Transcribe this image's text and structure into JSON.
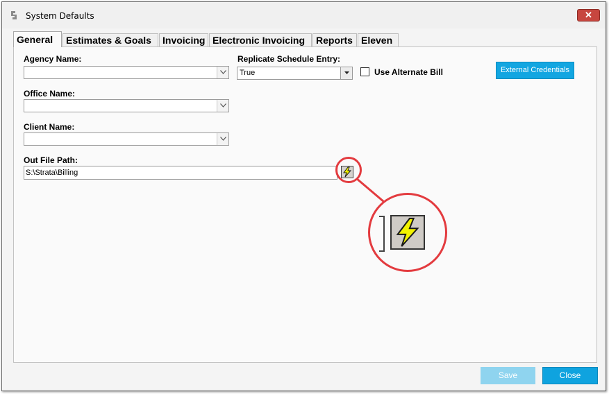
{
  "window": {
    "title": "System Defaults",
    "close_glyph": "✕"
  },
  "tabs": [
    {
      "label": "General",
      "active": true
    },
    {
      "label": "Estimates & Goals",
      "active": false
    },
    {
      "label": "Invoicing",
      "active": false
    },
    {
      "label": "Electronic Invoicing",
      "active": false
    },
    {
      "label": "Reports",
      "active": false
    },
    {
      "label": "Eleven",
      "active": false
    }
  ],
  "form": {
    "agency_name": {
      "label": "Agency Name:",
      "value": ""
    },
    "replicate_schedule_entry": {
      "label": "Replicate Schedule Entry:",
      "value": "True"
    },
    "use_alternate_bill": {
      "label": "Use Alternate Bill",
      "checked": false
    },
    "external_credentials_label": "External Credentials",
    "office_name": {
      "label": "Office Name:",
      "value": ""
    },
    "client_name": {
      "label": "Client Name:",
      "value": ""
    },
    "out_file_path": {
      "label": "Out File Path:",
      "value": "S:\\Strata\\Billing"
    }
  },
  "footer": {
    "save_label": "Save",
    "close_label": "Close"
  },
  "colors": {
    "accent": "#0fa3df",
    "accent_disabled": "#8fd4ef",
    "highlight_ring": "#e33b3f",
    "lightning": "#f2f200"
  },
  "icons": {
    "app": "app-logo-icon",
    "browse": "lightning-icon",
    "dropdown": "chevron-down-icon"
  }
}
